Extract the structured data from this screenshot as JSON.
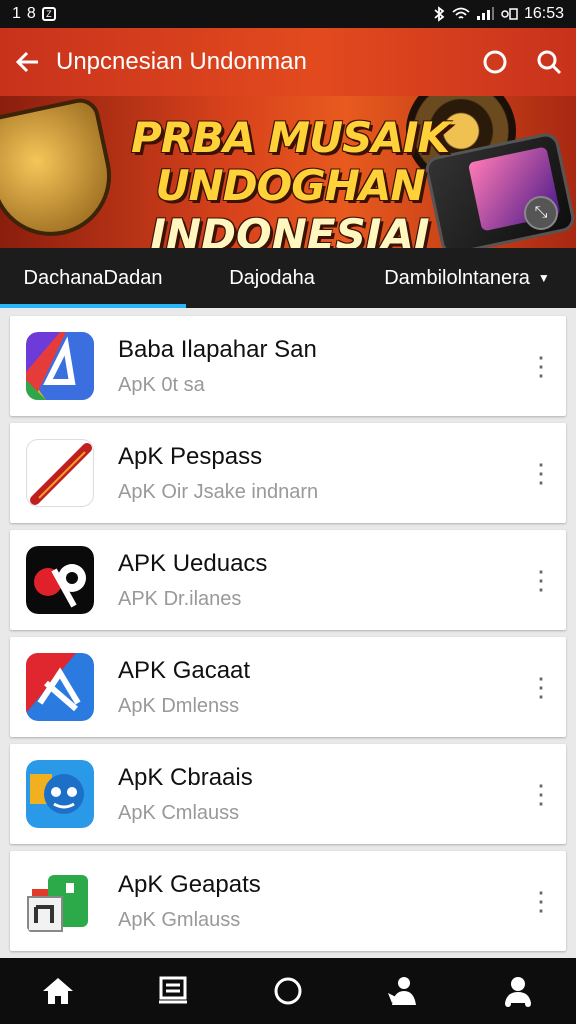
{
  "status": {
    "left_text": "1",
    "left_digit": "8",
    "time": "16:53"
  },
  "app_bar": {
    "title": "Unpcnesian Undonman"
  },
  "banner": {
    "line1": "PRBA MUSAIK UNDOGHAN",
    "line2": "INDONESIAI"
  },
  "tabs": [
    {
      "label": "DachanaDadan",
      "active": true
    },
    {
      "label": "Dajodaha",
      "active": false
    },
    {
      "label": "Dambilolntanera",
      "active": false
    }
  ],
  "apps": [
    {
      "title": "Baba Ilapahar San",
      "subtitle": "ApK 0t sa",
      "icon": "triangle-a-icon"
    },
    {
      "title": "ApK Pespass",
      "subtitle": "ApK Oir Jsake indnarn",
      "icon": "red-slash-icon"
    },
    {
      "title": "APK Ueduacs",
      "subtitle": "APK Dr.ilanes",
      "icon": "scissors-logo-icon"
    },
    {
      "title": "APK Gacaat",
      "subtitle": "ApK Dmlenss",
      "icon": "red-blue-x-icon"
    },
    {
      "title": "ApK Cbraais",
      "subtitle": "ApK Cmlauss",
      "icon": "blue-mascot-icon"
    },
    {
      "title": "ApK Geapats",
      "subtitle": "ApK Gmlauss",
      "icon": "green-bag-icon"
    }
  ],
  "colors": {
    "app_bar": "#d8421c",
    "tab_indicator": "#29b6f6",
    "list_bg": "#e9e9e9"
  }
}
